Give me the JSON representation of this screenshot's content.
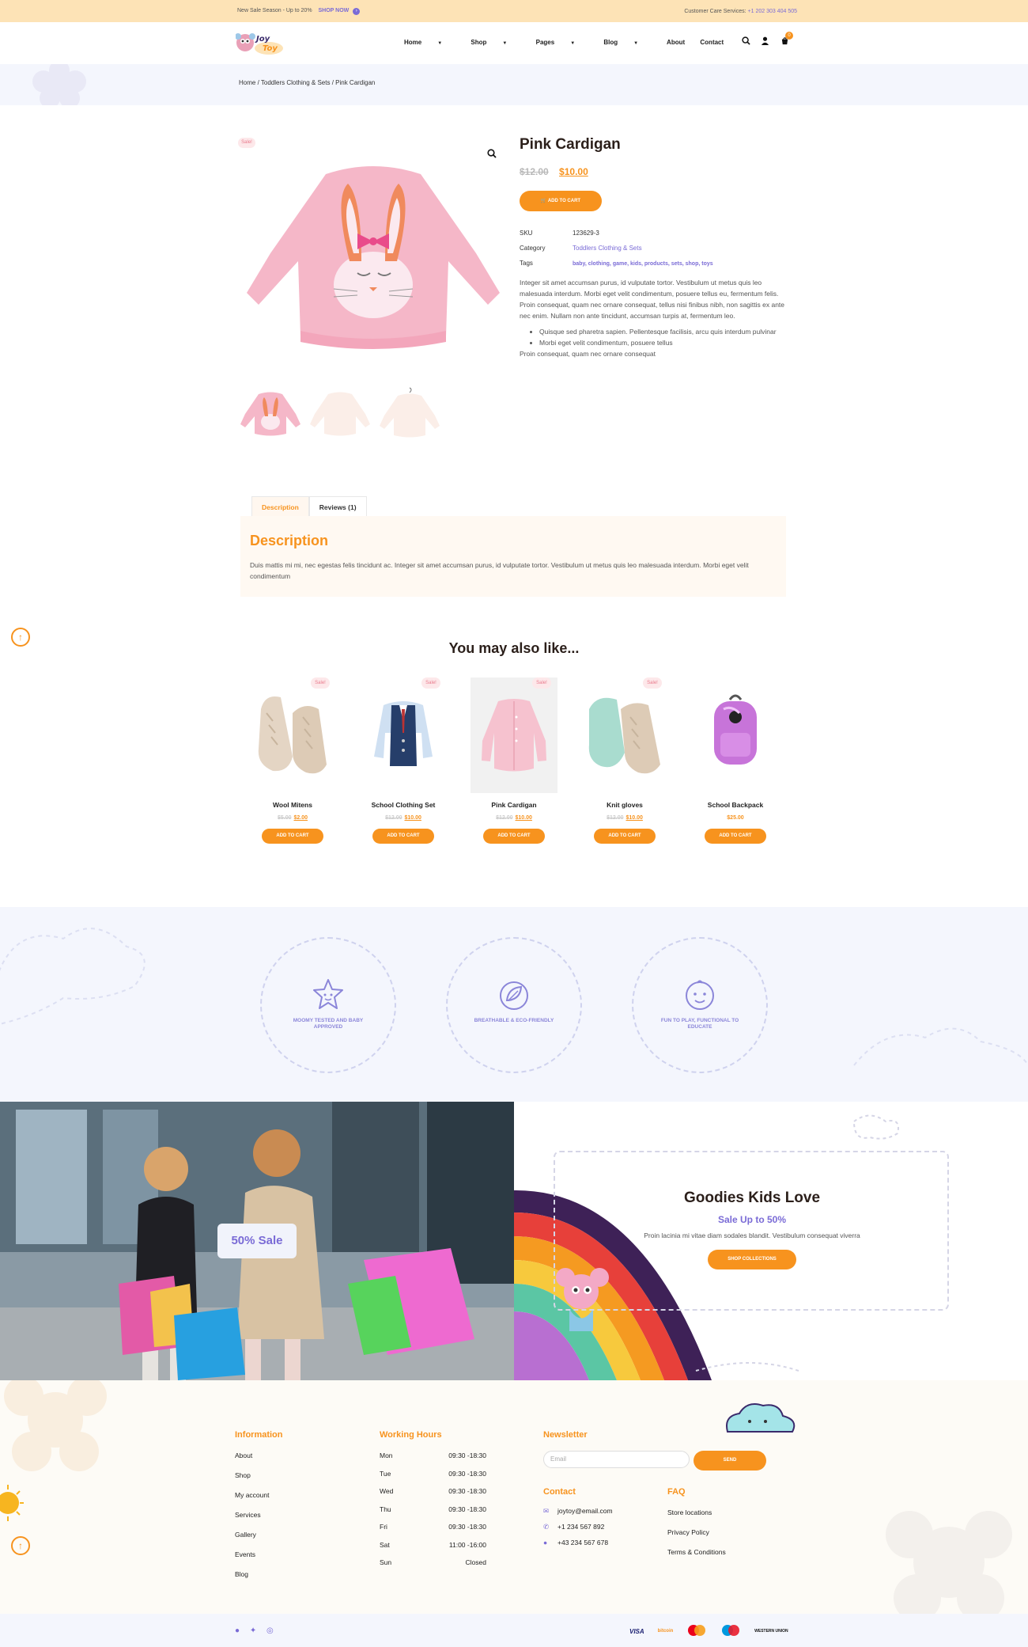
{
  "topbar": {
    "promo": "New Sale Season - Up to 20%",
    "shop_now": "SHOP NOW",
    "care_label": "Customer Care Services:",
    "care_phone": "+1 202 303 404 505"
  },
  "header": {
    "logo_top": "Joy",
    "logo_bottom": "Toy",
    "nav": [
      "Home",
      "Shop",
      "Pages",
      "Blog",
      "About",
      "Contact"
    ],
    "cart_count": "0"
  },
  "breadcrumb": "Home / Toddlers Clothing & Sets / Pink Cardigan",
  "product": {
    "sale_badge": "Sale!",
    "title": "Pink Cardigan",
    "old_price": "$12.00",
    "new_price": "$10.00",
    "add_to_cart": "ADD TO CART",
    "sku_label": "SKU",
    "sku": "123629-3",
    "category_label": "Category",
    "category": "Toddlers Clothing & Sets",
    "tags_label": "Tags",
    "tags": "baby, clothing, game, kids, products, sets, shop, toys",
    "description": "Integer sit amet accumsan purus, id vulputate tortor. Vestibulum ut metus quis leo malesuada interdum. Morbi eget velit condimentum, posuere tellus eu, fermentum felis. Proin consequat, quam nec ornare consequat, tellus nisi finibus nibh, non sagittis ex ante nec enim. Nullam non ante tincidunt, accumsan turpis at, fermentum leo.",
    "bullets": [
      "Quisque sed pharetra sapien. Pellentesque facilisis, arcu quis interdum pulvinar",
      "Morbi eget velit condimentum, posuere tellus"
    ],
    "tail": "Proin consequat, quam nec ornare consequat"
  },
  "tabs": {
    "description": "Description",
    "reviews": "Reviews (1)"
  },
  "description_panel": {
    "heading": "Description",
    "text": "Duis mattis mi mi, nec egestas felis tincidunt ac. Integer sit amet accumsan purus, id vulputate tortor. Vestibulum ut metus quis leo malesuada interdum. Morbi eget velit condimentum"
  },
  "related": {
    "heading": "You may also like...",
    "items": [
      {
        "name": "Wool Mitens",
        "old": "$5.00",
        "new": "$2.00",
        "sale": "Sale!",
        "button": "ADD TO CART"
      },
      {
        "name": "School Clothing Set",
        "old": "$12.00",
        "new": "$10.00",
        "sale": "Sale!",
        "button": "ADD TO CART"
      },
      {
        "name": "Pink Cardigan",
        "old": "$12.00",
        "new": "$10.00",
        "sale": "Sale!",
        "button": "ADD TO CART"
      },
      {
        "name": "Knit gloves",
        "old": "$12.00",
        "new": "$10.00",
        "sale": "Sale!",
        "button": "ADD TO CART"
      },
      {
        "name": "School Backpack",
        "price": "$25.00",
        "button": "ADD TO CART"
      }
    ]
  },
  "features": [
    "MOOMY TESTED AND BABY APPROVED",
    "BREATHABLE & ECO-FRIENDLY",
    "FUN TO PLAY, FUNCTIONAL TO EDUCATE"
  ],
  "promo": {
    "pill": "50% Sale",
    "heading": "Goodies Kids Love",
    "sub": "Sale Up to 50%",
    "text": "Proin lacinia mi vitae diam sodales blandit. Vestibulum consequat viverra",
    "button": "SHOP COLLECTIONS"
  },
  "footer": {
    "info_heading": "Information",
    "info_links": [
      "About",
      "Shop",
      "My account",
      "Services",
      "Gallery",
      "Events",
      "Blog"
    ],
    "hours_heading": "Working Hours",
    "hours": [
      {
        "day": "Mon",
        "time": "09:30 -18:30"
      },
      {
        "day": "Tue",
        "time": "09:30 -18:30"
      },
      {
        "day": "Wed",
        "time": "09:30 -18:30"
      },
      {
        "day": "Thu",
        "time": "09:30 -18:30"
      },
      {
        "day": "Fri",
        "time": "09:30 -18:30"
      },
      {
        "day": "Sat",
        "time": "11:00 -16:00"
      },
      {
        "day": "Sun",
        "time": "Closed"
      }
    ],
    "newsletter_heading": "Newsletter",
    "email_placeholder": "Email",
    "send": "SEND",
    "contact_heading": "Contact",
    "email": "joytoy@email.com",
    "phone1": "+1 234 567 892",
    "phone2": "+43 234 567 678",
    "faq_heading": "FAQ",
    "faq_links": [
      "Store locations",
      "Privacy Policy",
      "Terms & Conditions"
    ]
  },
  "payments": [
    "VISA",
    "bitcoin",
    "mastercard",
    "maestro",
    "WESTERN UNION"
  ],
  "colors": {
    "accent": "#f7931e",
    "purple": "#7a6bd6",
    "topbar": "#fde3b6",
    "band": "#f4f6fd"
  }
}
